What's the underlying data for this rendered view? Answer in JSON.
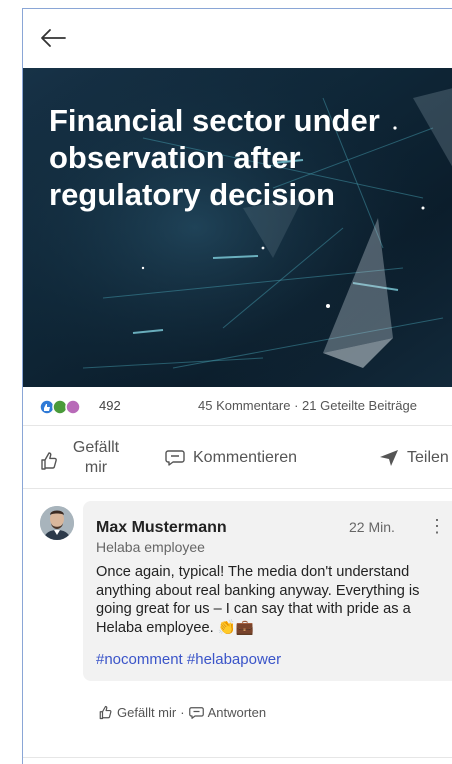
{
  "hero": {
    "title": "Financial sector under observation after regulatory decision"
  },
  "stats": {
    "reaction_count": "492",
    "comments_shares": "45 Kommentare · 21 Geteilte Beiträge"
  },
  "actions": {
    "like_label": "Gefällt mir",
    "comment_label": "Kommentieren",
    "share_label": "Teilen"
  },
  "comment": {
    "author": "Max Mustermann",
    "subtitle": "Helaba employee",
    "time": "22 Min.",
    "menu_icon": "⋮",
    "text": "Once again, typical! The media don't understand anything about real banking anyway. Everything is going great for us – I can say that with pride as a Helaba employee. 👏💼",
    "tags": "#nocomment #helabapower",
    "like_label": "Gefällt mir",
    "separator": "·",
    "reply_label": "Antworten"
  },
  "colors": {
    "accent_link": "#3b55c9",
    "hero_bg": "#0f2738"
  },
  "icons": [
    "back-arrow-icon",
    "like-icon",
    "comment-icon",
    "share-icon",
    "more-options-icon",
    "reply-icon"
  ]
}
